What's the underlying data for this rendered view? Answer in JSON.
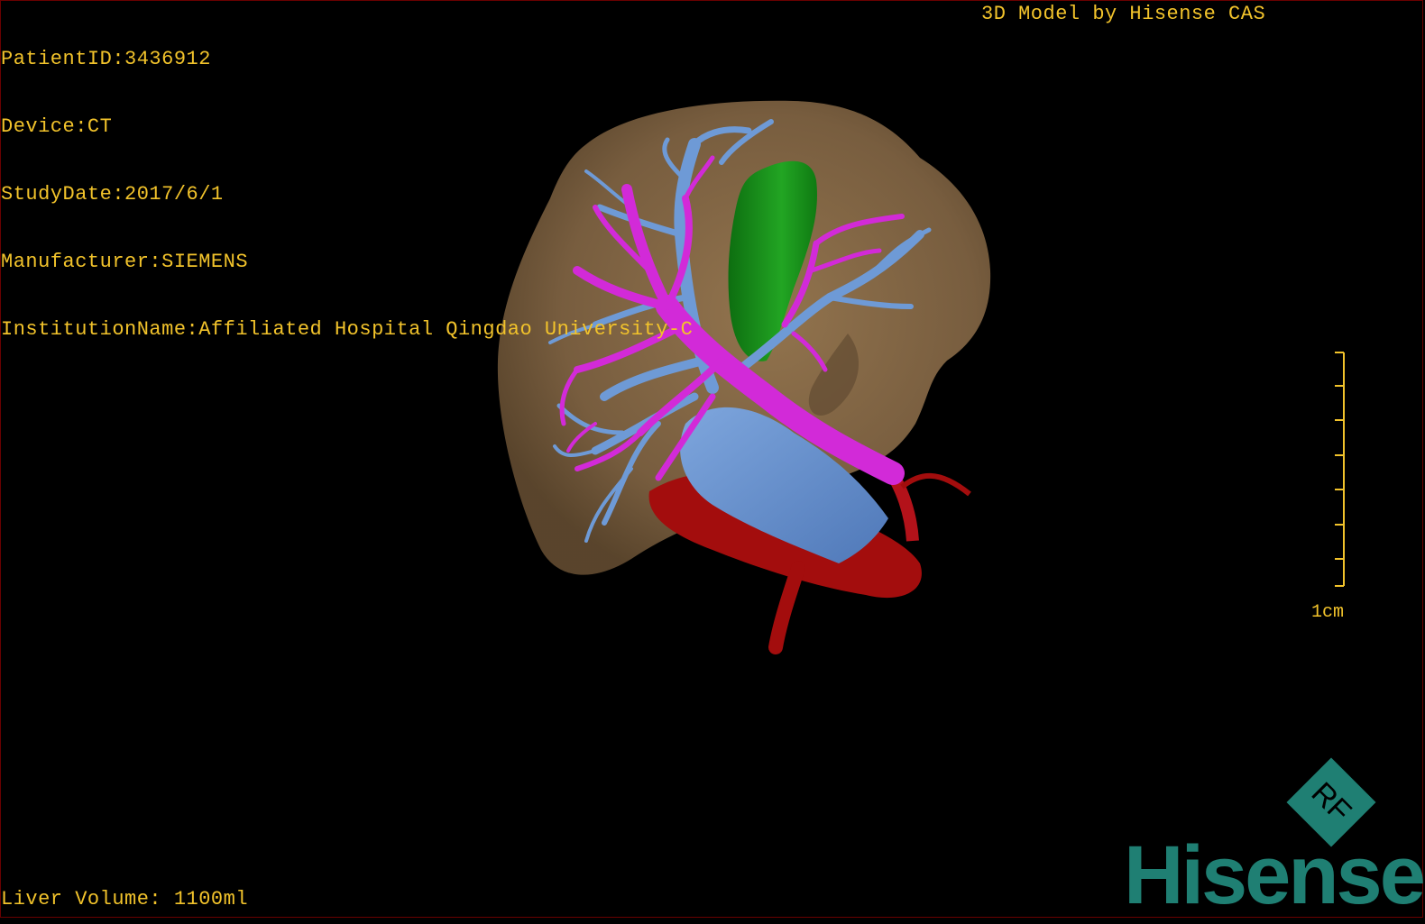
{
  "header": {
    "patient_id": "PatientID:3436912",
    "device": "Device:CT",
    "study_date": "StudyDate:2017/6/1",
    "manufacturer": "Manufacturer:SIEMENS",
    "institution": "InstitutionName:Affiliated Hospital Qingdao University-C"
  },
  "watermark": "3D Model by Hisense CAS",
  "footer": {
    "liver_volume": "Liver Volume: 1100ml"
  },
  "scale": {
    "label": "1cm"
  },
  "logo": {
    "brand": "Hisense",
    "badge": "RF",
    "color": "#1f7f73"
  },
  "colors": {
    "overlay_text": "#f2c32b",
    "liver": "#7d6140",
    "portal_vein": "#d22ad8",
    "hepatic_vein": "#6e9ad6",
    "ivc": "#6a8fcc",
    "artery": "#a30d0d",
    "gallbladder": "#1f9a1f"
  }
}
